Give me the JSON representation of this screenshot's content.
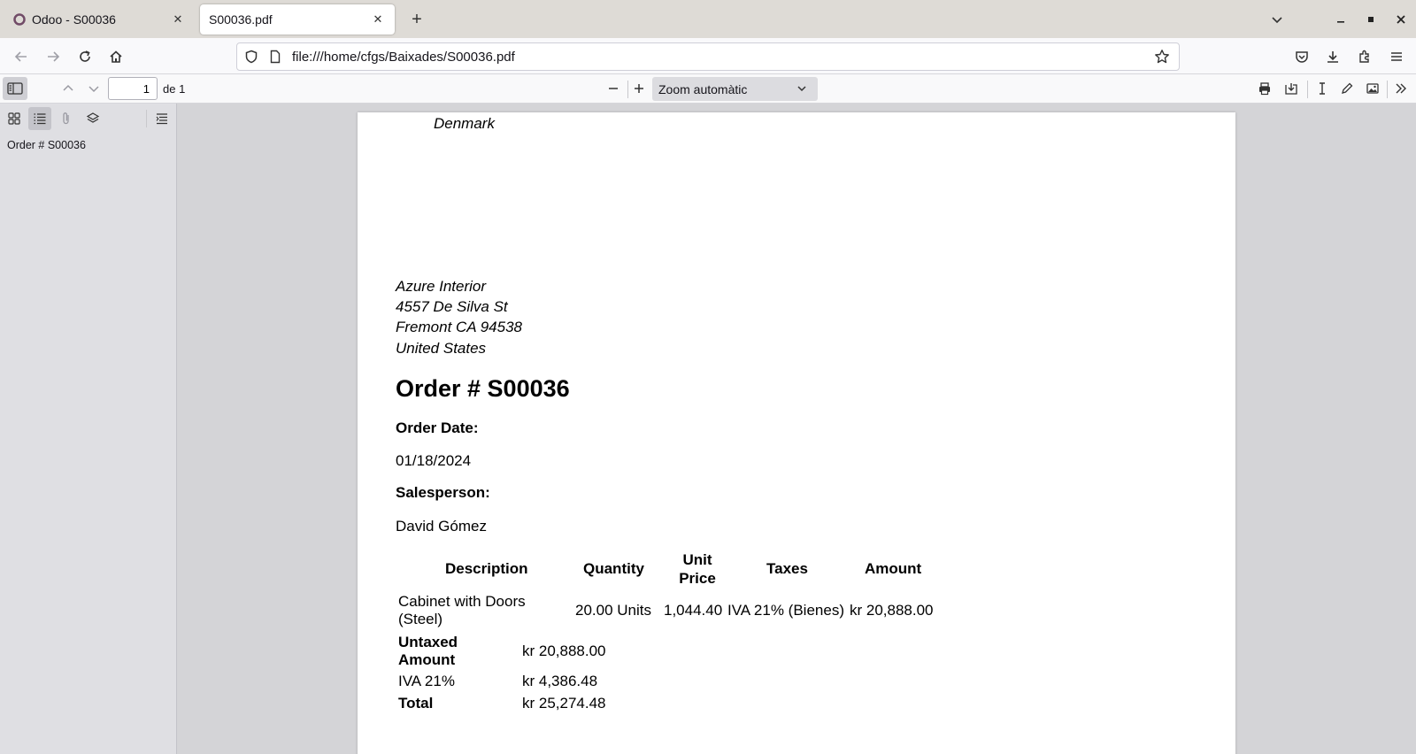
{
  "browser": {
    "tabs": [
      {
        "title": "Odoo - S00036",
        "active": false
      },
      {
        "title": "S00036.pdf",
        "active": true
      }
    ],
    "url": "file:///home/cfgs/Baixades/S00036.pdf"
  },
  "pdf_toolbar": {
    "page_number": "1",
    "page_count_label": "de 1",
    "zoom_label": "Zoom automàtic"
  },
  "sidebar": {
    "outline": [
      "Order # S00036"
    ]
  },
  "document": {
    "company_country": "Denmark",
    "customer": {
      "name": "Azure Interior",
      "street": "4557 De Silva St",
      "city_line": "Fremont CA 94538",
      "country": "United States"
    },
    "title": "Order # S00036",
    "order_date_label": "Order Date:",
    "order_date": "01/18/2024",
    "salesperson_label": "Salesperson:",
    "salesperson": "David Gómez",
    "table": {
      "headers": {
        "description": "Description",
        "quantity": "Quantity",
        "unit_price_1": "Unit",
        "unit_price_2": "Price",
        "taxes": "Taxes",
        "amount": "Amount"
      },
      "rows": [
        {
          "description_1": "Cabinet with Doors",
          "description_2": "(Steel)",
          "quantity": "20.00 Units",
          "unit_price": "1,044.40",
          "taxes": "IVA 21% (Bienes)",
          "amount": "kr 20,888.00"
        }
      ]
    },
    "totals": {
      "untaxed_label_1": "Untaxed",
      "untaxed_label_2": "Amount",
      "untaxed_value": "kr 20,888.00",
      "tax_label": "IVA 21%",
      "tax_value": "kr 4,386.48",
      "total_label": "Total",
      "total_value": "kr 25,274.48"
    }
  },
  "colors": {
    "odoo_brand": "#714b67",
    "tabstrip_bg": "#dedbd6",
    "viewer_bg": "#d4d4d7"
  }
}
